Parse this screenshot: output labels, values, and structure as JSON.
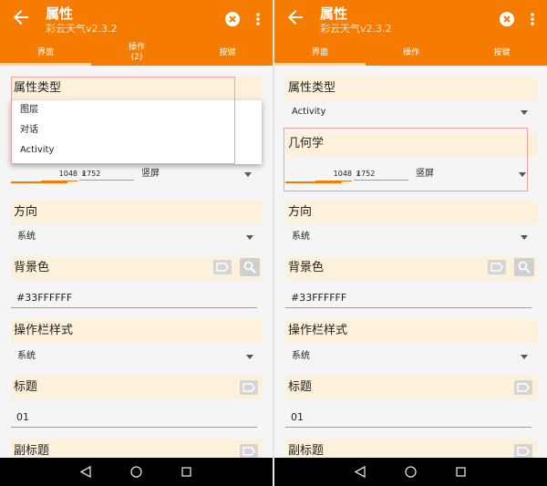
{
  "left": {
    "app_title": "属性",
    "app_subtitle": "彩云天气v2.3.2",
    "tabs": [
      {
        "label": "界面"
      },
      {
        "label": "操作\n(2)"
      },
      {
        "label": "按键"
      }
    ],
    "section_type": "属性类型",
    "popup_options": [
      "图层",
      "对话",
      "Activity"
    ],
    "geometry": {
      "width": "1048",
      "x": "x",
      "height": "1752",
      "orientation": "竖屏"
    },
    "section_direction": "方向",
    "direction_value": "系统",
    "section_bgcolor": "背景色",
    "bgcolor_value": "#33FFFFFF",
    "section_actionbar": "操作栏样式",
    "actionbar_value": "系统",
    "section_title": "标题",
    "title_value": "01",
    "section_subtitle": "副标题"
  },
  "right": {
    "app_title": "属性",
    "app_subtitle": "彩云天气v2.3.2",
    "tabs": [
      {
        "label": "界面"
      },
      {
        "label": "操作"
      },
      {
        "label": "按键"
      }
    ],
    "section_type": "属性类型",
    "type_value": "Activity",
    "section_geometry": "几何学",
    "geometry": {
      "width": "1048",
      "x": "x",
      "height": "1752",
      "orientation": "竖屏"
    },
    "section_direction": "方向",
    "direction_value": "系统",
    "section_bgcolor": "背景色",
    "bgcolor_value": "#33FFFFFF",
    "section_actionbar": "操作栏样式",
    "actionbar_value": "系统",
    "section_title": "标题",
    "title_value": "01",
    "section_subtitle": "副标题"
  },
  "icons": {
    "back": "arrow-left-icon",
    "close": "close-circle-icon",
    "more": "more-vert-icon",
    "label": "label-tag-icon",
    "search": "search-icon",
    "nav_back": "nav-back-icon",
    "nav_home": "nav-home-icon",
    "nav_recent": "nav-recent-icon"
  },
  "colors": {
    "accent": "#f57c00",
    "section_bg": "#fdf1dc",
    "annotation": "#f2a0a0"
  }
}
